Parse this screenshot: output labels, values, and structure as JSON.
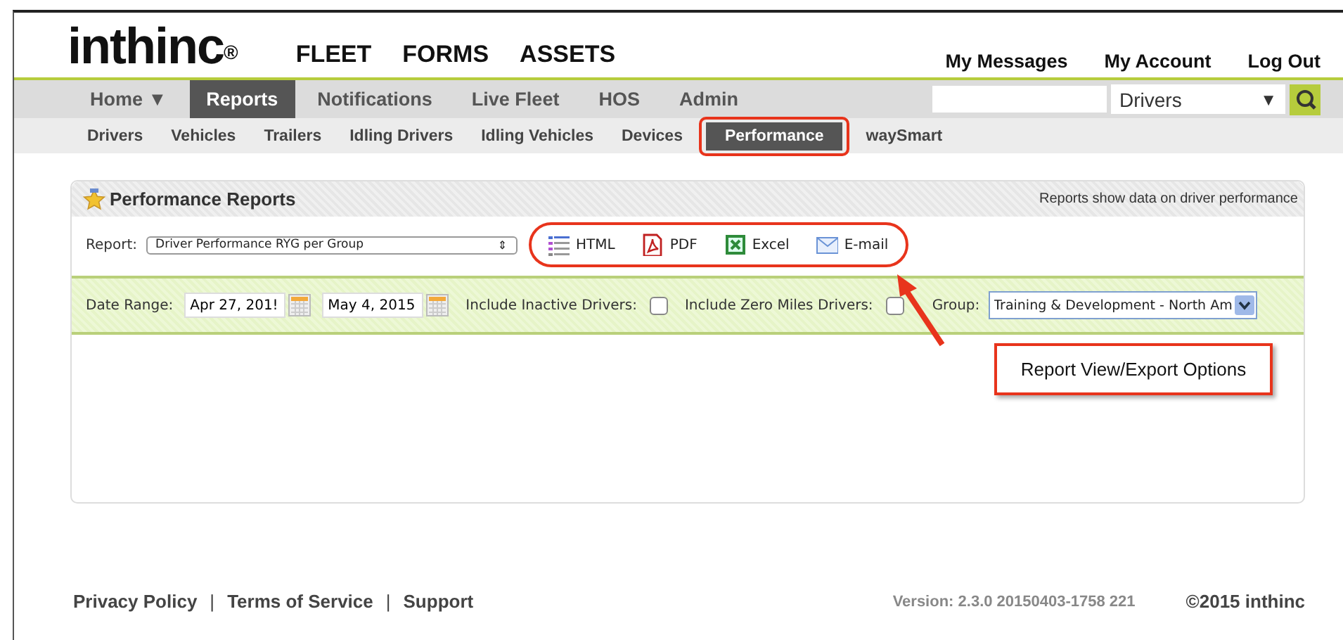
{
  "logo": {
    "text": "inthinc",
    "mark": "®"
  },
  "top_nav": [
    {
      "label": "FLEET"
    },
    {
      "label": "FORMS"
    },
    {
      "label": "ASSETS"
    }
  ],
  "user_links": [
    {
      "label": "My Messages"
    },
    {
      "label": "My Account"
    },
    {
      "label": "Log Out"
    }
  ],
  "main_nav": [
    {
      "label": "Home",
      "caret": "▼",
      "selected": false
    },
    {
      "label": "Reports",
      "selected": true
    },
    {
      "label": "Notifications",
      "selected": false
    },
    {
      "label": "Live Fleet",
      "selected": false
    },
    {
      "label": "HOS",
      "selected": false
    },
    {
      "label": "Admin",
      "selected": false
    }
  ],
  "search": {
    "scope": "Drivers",
    "caret": "▼"
  },
  "sub_nav": [
    {
      "label": "Drivers",
      "selected": false
    },
    {
      "label": "Vehicles",
      "selected": false
    },
    {
      "label": "Trailers",
      "selected": false
    },
    {
      "label": "Idling Drivers",
      "selected": false
    },
    {
      "label": "Idling Vehicles",
      "selected": false
    },
    {
      "label": "Devices",
      "selected": false
    },
    {
      "label": "Performance",
      "selected": true,
      "highlighted": true
    },
    {
      "label": "waySmart",
      "selected": false
    }
  ],
  "panel": {
    "title": "Performance Reports",
    "note": "Reports show data on driver performance",
    "report_label": "Report:",
    "report_value": "Driver Performance RYG per Group",
    "report_caret": "⇕",
    "exports": [
      {
        "kind": "html",
        "label": "HTML"
      },
      {
        "kind": "pdf",
        "label": "PDF"
      },
      {
        "kind": "excel",
        "label": "Excel"
      },
      {
        "kind": "email",
        "label": "E-mail"
      }
    ],
    "filters": {
      "date_label": "Date Range:",
      "start": "Apr 27, 201!",
      "end": "May 4, 2015",
      "checks": [
        {
          "label": "Include Inactive Drivers:",
          "checked": false
        },
        {
          "label": "Include Zero Miles Drivers:",
          "checked": false
        }
      ],
      "group_label": "Group:",
      "group_value": "Training & Development - North Am"
    }
  },
  "callout": {
    "text": "Report View/Export Options"
  },
  "footer": {
    "links": [
      {
        "label": "Privacy Policy"
      },
      {
        "label": "Terms of Service"
      },
      {
        "label": "Support"
      }
    ],
    "separator": "|",
    "version": "Version: 2.3.0 20150403-1758 221",
    "copyright": "©2015 inthinc"
  }
}
